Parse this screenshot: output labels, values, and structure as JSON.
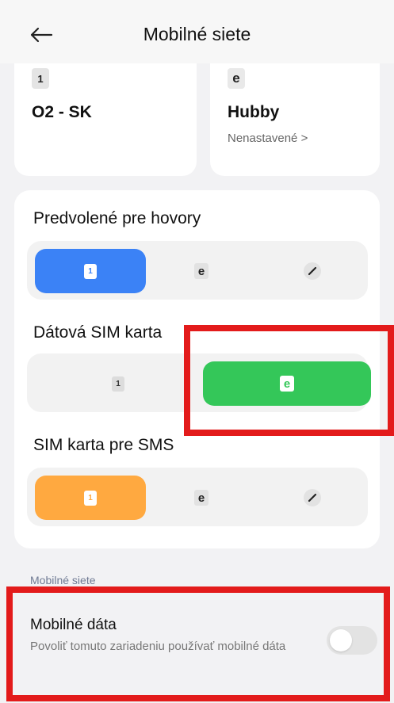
{
  "header": {
    "title": "Mobilné siete",
    "back_icon": "arrow-left-icon"
  },
  "sims": [
    {
      "slot": "1",
      "name": "O2 - SK",
      "status": ""
    },
    {
      "slot": "e",
      "name": "Hubby",
      "status": "Nenastavené >"
    }
  ],
  "groups": {
    "calls": {
      "title": "Predvolené pre hovory",
      "options": [
        "1",
        "e",
        ""
      ],
      "selected": 0,
      "selected_color": "#3b82f6"
    },
    "data": {
      "title": "Dátová SIM karta",
      "options": [
        "1",
        "e"
      ],
      "selected": 1,
      "selected_color": "#34c759"
    },
    "sms": {
      "title": "SIM karta pre SMS",
      "options": [
        "1",
        "e",
        ""
      ],
      "selected": 0,
      "selected_color": "#ffa940"
    }
  },
  "section": {
    "label": "Mobilné siete"
  },
  "mobile_data": {
    "title": "Mobilné dáta",
    "description": "Povoliť tomuto zariadeniu používať mobilné dáta",
    "enabled": false
  },
  "colors": {
    "highlight": "#e31b1b",
    "background": "#f2f2f4"
  }
}
